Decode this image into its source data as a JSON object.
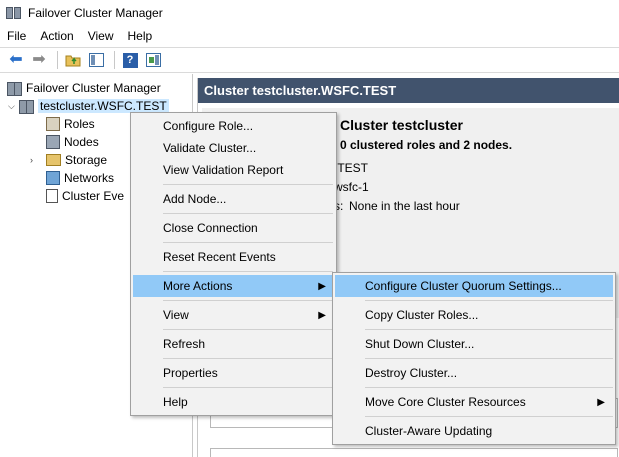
{
  "window": {
    "title": "Failover Cluster Manager"
  },
  "menubar": {
    "items": [
      "File",
      "Action",
      "View",
      "Help"
    ]
  },
  "toolbar": {
    "buttons": [
      "back-arrow-icon",
      "forward-arrow-icon",
      "up-folder-icon",
      "show-hide-console-tree-icon",
      "help-icon",
      "show-hide-action-pane-icon"
    ]
  },
  "tree": {
    "root": "Failover Cluster Manager",
    "cluster": "testcluster.WSFC.TEST",
    "children": [
      "Roles",
      "Nodes",
      "Storage",
      "Networks",
      "Cluster Eve"
    ]
  },
  "right_pane": {
    "header": "Cluster testcluster.WSFC.TEST",
    "summary_title": "Cluster testcluster",
    "summary_sub": "0 clustered roles and 2 nodes.",
    "line1": ".TEST",
    "line2": "wsfc-1",
    "line3_label": "s:",
    "line3_value": "None in the last hour"
  },
  "context_menu": {
    "items": [
      "Configure Role...",
      "Validate Cluster...",
      "View Validation Report",
      "Add Node...",
      "Close Connection",
      "Reset Recent Events",
      "More Actions",
      "View",
      "Refresh",
      "Properties",
      "Help"
    ]
  },
  "submenu": {
    "items": [
      "Configure Cluster Quorum Settings...",
      "Copy Cluster Roles...",
      "Shut Down Cluster...",
      "Destroy Cluster...",
      "Move Core Cluster Resources",
      "Cluster-Aware Updating"
    ]
  },
  "colors": {
    "highlight": "#91c9f7",
    "selection": "#cce8ff",
    "pane_header": "#41536d"
  }
}
